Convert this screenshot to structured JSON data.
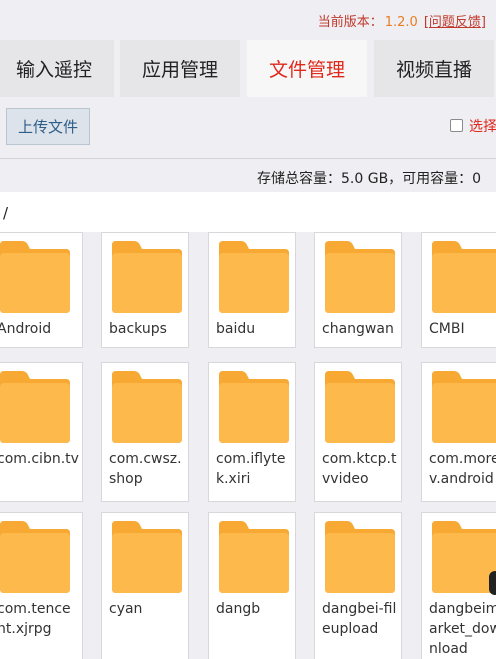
{
  "header": {
    "version_label": "当前版本：",
    "version_value": "1.2.0",
    "feedback_open": "[",
    "feedback_link": "问题反馈",
    "feedback_close": "]"
  },
  "tabs": [
    {
      "label": "输入遥控",
      "active": false
    },
    {
      "label": "应用管理",
      "active": false
    },
    {
      "label": "文件管理",
      "active": true
    },
    {
      "label": "视频直播",
      "active": false
    }
  ],
  "toolbar": {
    "upload_label": "上传文件",
    "select_all_label": "选择"
  },
  "storage": {
    "text": "存储总容量：5.0 GB，可用容量：0"
  },
  "path": "/",
  "files": [
    {
      "name": "Android"
    },
    {
      "name": "backups"
    },
    {
      "name": "baidu"
    },
    {
      "name": "changwan"
    },
    {
      "name": "CMBI"
    },
    {
      "name": "com.cibn.tv"
    },
    {
      "name": "com.cwsz.shop"
    },
    {
      "name": "com.iflytek.xiri"
    },
    {
      "name": "com.ktcp.tvvideo"
    },
    {
      "name": "com.moretv.android"
    },
    {
      "name": "com.tencent.xjrpg"
    },
    {
      "name": "cyan"
    },
    {
      "name": "dangb"
    },
    {
      "name": "dangbei-fileupload"
    },
    {
      "name": "dangbeimarket_download"
    }
  ],
  "colors": {
    "accent_red": "#e0281b",
    "version_orange": "#e67e22",
    "folder_yellow": "#fdb94b",
    "folder_tab": "#f7a934"
  },
  "icons": {
    "folder": "folder-icon"
  }
}
